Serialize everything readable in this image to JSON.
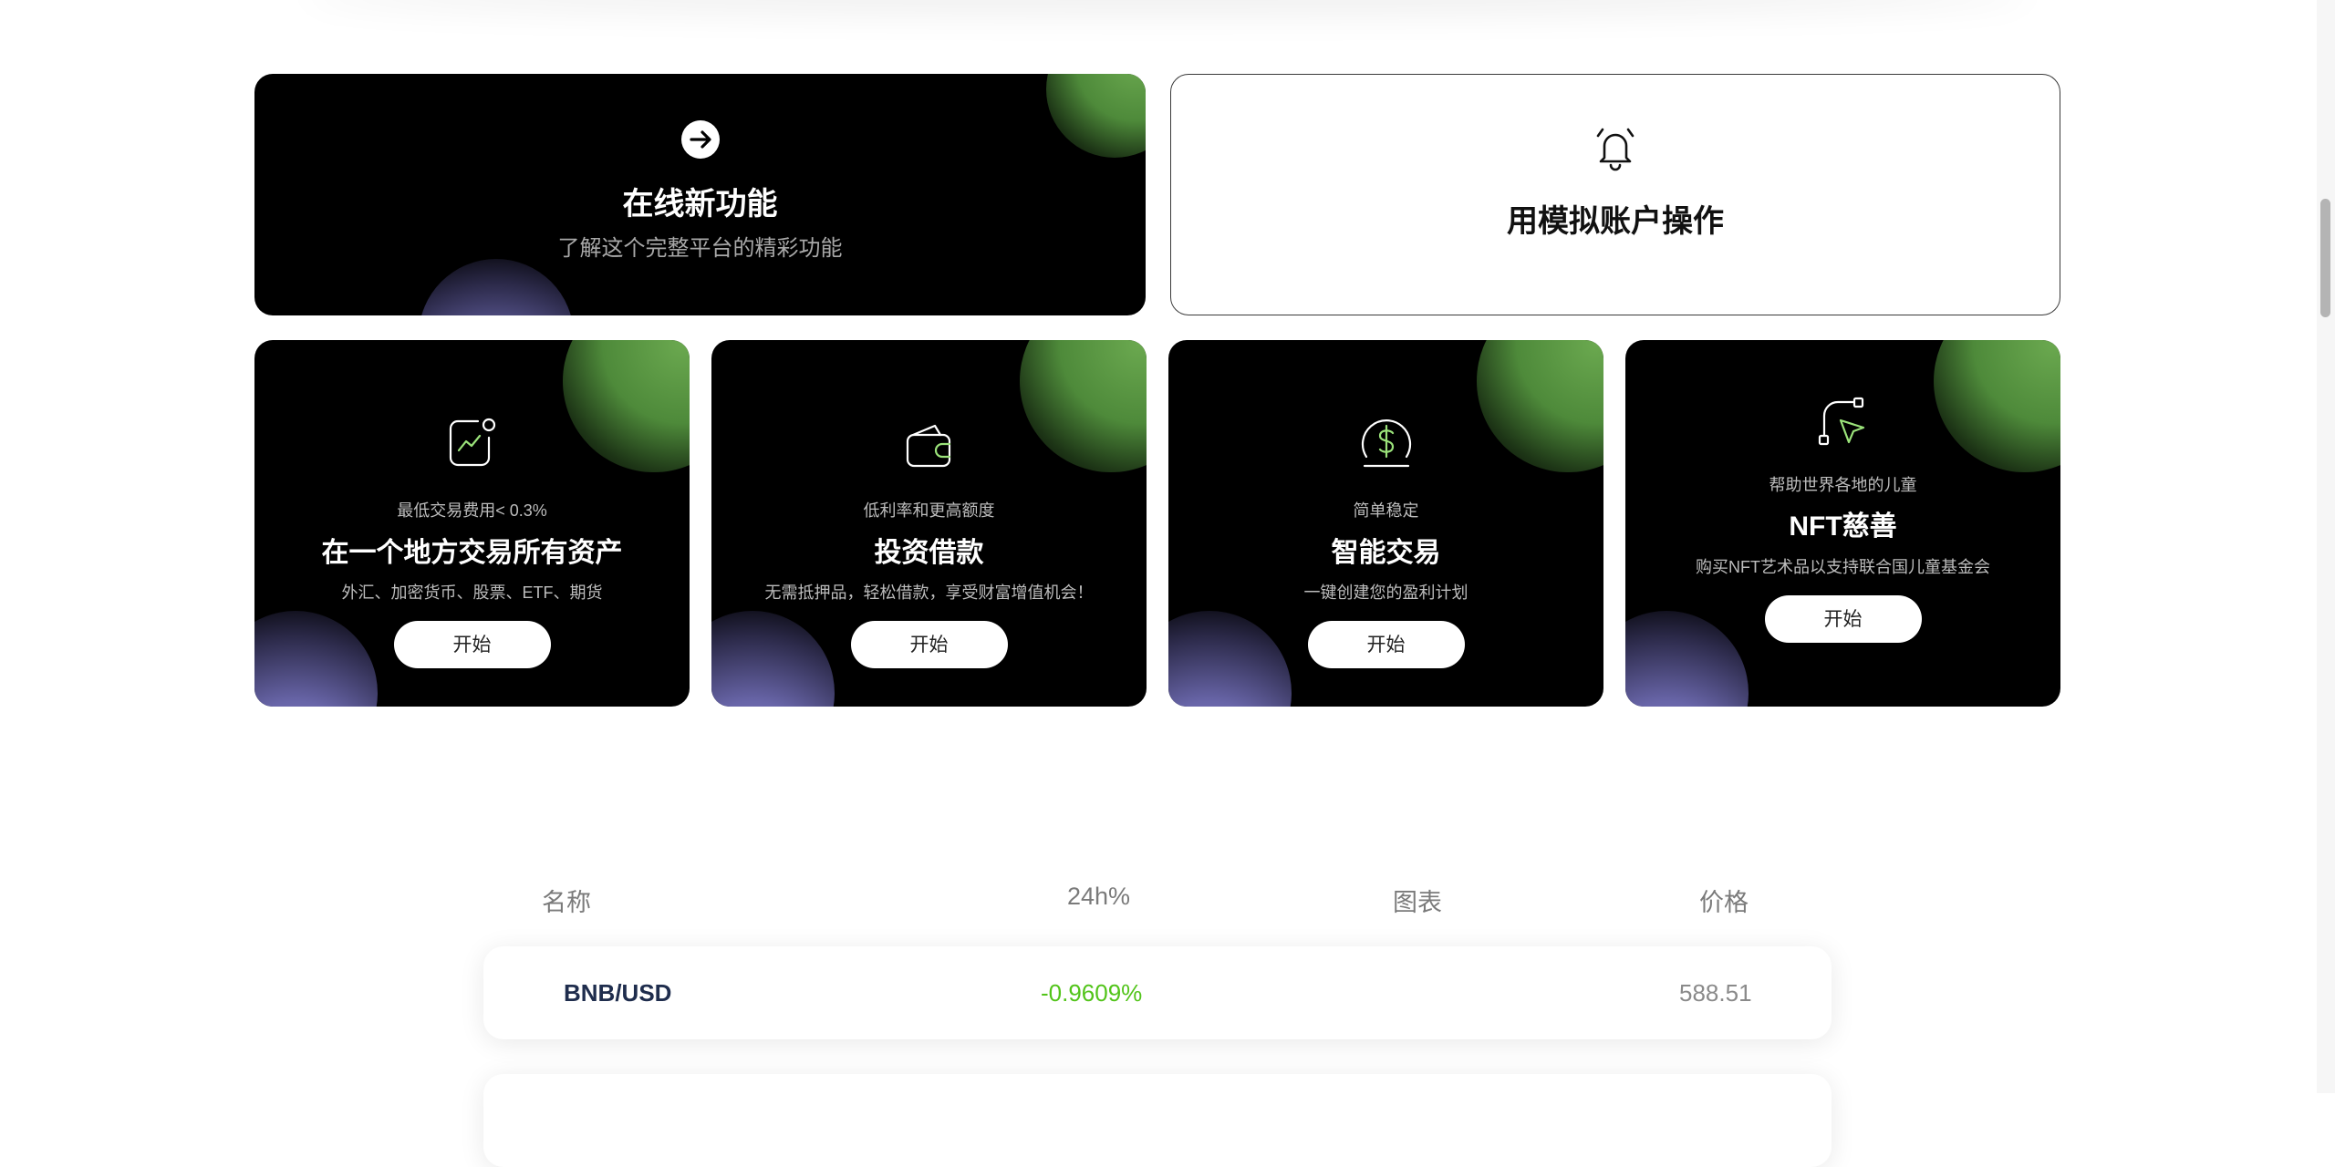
{
  "feature_cards": [
    {
      "title": "在线新功能",
      "subtitle": "了解这个完整平台的精彩功能",
      "icon": "arrow-right-circle-icon"
    },
    {
      "title": "用模拟账户操作",
      "icon": "bell-icon"
    }
  ],
  "product_cards": [
    {
      "kicker": "最低交易费用< 0.3%",
      "title": "在一个地方交易所有资产",
      "desc": "外汇、加密货币、股票、ETF、期货",
      "button": "开始",
      "icon": "chart-icon"
    },
    {
      "kicker": "低利率和更高额度",
      "title": "投资借款",
      "desc": "无需抵押品，轻松借款，享受财富增值机会！",
      "button": "开始",
      "icon": "wallet-icon"
    },
    {
      "kicker": "简单稳定",
      "title": "智能交易",
      "desc": "一键创建您的盈利计划",
      "button": "开始",
      "icon": "dollar-coin-icon"
    },
    {
      "kicker": "帮助世界各地的儿童",
      "title": "NFT慈善",
      "desc": "购买NFT艺术品以支持联合国儿童基金会",
      "button": "开始",
      "icon": "pen-tool-icon"
    }
  ],
  "market_table": {
    "headers": [
      "名称",
      "24h%",
      "图表",
      "价格"
    ],
    "rows": [
      {
        "name": "BNB/USD",
        "change": "-0.9609%",
        "price": "588.51"
      }
    ]
  },
  "colors": {
    "accent_green": "#9be37a",
    "change_color": "#52c41a",
    "pair_color": "#1f2d4d"
  }
}
